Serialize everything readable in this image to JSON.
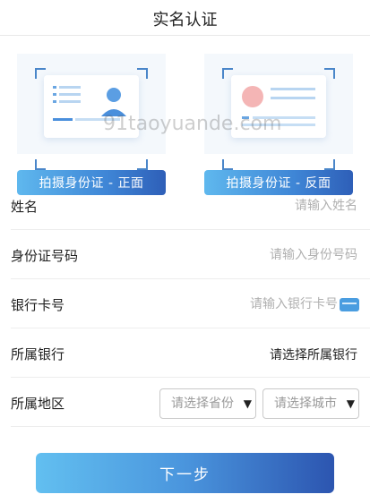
{
  "header": {
    "title": "实名认证"
  },
  "id_cards": {
    "front_label": "拍摄身份证 - 正面",
    "back_label": "拍摄身份证 - 反面"
  },
  "form": {
    "name": {
      "label": "姓名",
      "placeholder": "请输入姓名"
    },
    "id_number": {
      "label": "身份证号码",
      "placeholder": "请输入身份号码"
    },
    "bank_card": {
      "label": "银行卡号",
      "placeholder": "请输入银行卡号"
    },
    "bank": {
      "label": "所属银行",
      "value": "请选择所属银行"
    },
    "region": {
      "label": "所属地区",
      "province_placeholder": "请选择省份",
      "city_placeholder": "请选择城市"
    }
  },
  "next_button": "下一步",
  "watermark": "91taoyuande.com",
  "colors": {
    "accent": "#3f86d6",
    "card_blue": "#4a9de0",
    "avatar_pink": "#f4b5b5"
  }
}
